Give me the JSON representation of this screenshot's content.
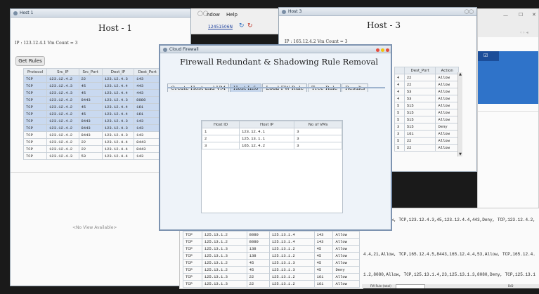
{
  "host1": {
    "title": "Host 1",
    "heading": "Host - 1",
    "ip_line": "IP : 123.12.4.1 Vm Count = 3",
    "get_rules": "Get Rules",
    "no_view": "<No View Available>",
    "columns": [
      "Protocol",
      "Src_IP",
      "Src_Port",
      "Dest_IP",
      "Dest_Port"
    ],
    "rows": [
      [
        "TCP",
        "123.12.4.2",
        "22",
        "123.12.4.3",
        "143"
      ],
      [
        "TCP",
        "123.12.4.3",
        "45",
        "123.12.4.4",
        "443"
      ],
      [
        "TCP",
        "123.12.4.3",
        "45",
        "123.12.4.4",
        "443"
      ],
      [
        "TCP",
        "123.12.4.2",
        "8443",
        "123.12.4.3",
        "8080"
      ],
      [
        "TCP",
        "123.12.4.2",
        "45",
        "123.12.4.4",
        "161"
      ],
      [
        "TCP",
        "123.12.4.2",
        "45",
        "123.12.4.4",
        "161"
      ],
      [
        "TCP",
        "123.12.4.2",
        "8443",
        "123.12.4.3",
        "143"
      ],
      [
        "TCP",
        "123.12.4.2",
        "8443",
        "123.12.4.3",
        "143"
      ],
      [
        "TCP",
        "123.12.4.2",
        "8443",
        "123.12.4.3",
        "143"
      ],
      [
        "TCP",
        "123.12.4.2",
        "22",
        "123.12.4.4",
        "8443"
      ],
      [
        "TCP",
        "123.12.4.2",
        "22",
        "123.12.4.4",
        "8443"
      ],
      [
        "TCP",
        "123.12.4.3",
        "53",
        "123.12.4.4",
        "143"
      ]
    ]
  },
  "menubar": {
    "window": "ndow",
    "help": "Help",
    "link": "12451506N"
  },
  "host3": {
    "title": "Host 3",
    "heading": "Host - 3",
    "ip_line": "IP : 165.12.4.2 Vm Count = 3",
    "columns": [
      "Dest_Port",
      "Action"
    ],
    "rows": [
      [
        "4",
        "22",
        "Allow"
      ],
      [
        "4",
        "22",
        "Allow"
      ],
      [
        "4",
        "53",
        "Allow"
      ],
      [
        "4",
        "53",
        "Allow"
      ],
      [
        "5",
        "515",
        "Allow"
      ],
      [
        "5",
        "515",
        "Allow"
      ],
      [
        "5",
        "515",
        "Allow"
      ],
      [
        "3",
        "515",
        "Deny"
      ],
      [
        "3",
        "161",
        "Allow"
      ],
      [
        "5",
        "22",
        "Allow"
      ],
      [
        "5",
        "22",
        "Allow"
      ]
    ]
  },
  "firewall": {
    "title": "Cloud Firewall",
    "heading": "Firewall Redundant & Shadowing Rule Removal",
    "tabs": [
      "Create Host and VM",
      "Host Info",
      "Load FW Rule",
      "Tree Rule",
      "Results"
    ],
    "active_tab": 1,
    "columns": [
      "Host ID",
      "Host IP",
      "No of VMs"
    ],
    "rows": [
      [
        "1",
        "123.12.4.1",
        "3"
      ],
      [
        "2",
        "125.13.1.1",
        "3"
      ],
      [
        "3",
        "165.12.4.2",
        "3"
      ]
    ]
  },
  "bottom_table": {
    "rows": [
      [
        "TCP",
        "125.13.1.2",
        "8080",
        "125.13.1.4",
        "143",
        "Allow"
      ],
      [
        "TCP",
        "125.13.1.2",
        "8080",
        "125.13.1.4",
        "143",
        "Allow"
      ],
      [
        "TCP",
        "125.13.1.3",
        "138",
        "125.13.1.2",
        "45",
        "Allow"
      ],
      [
        "TCP",
        "125.13.1.3",
        "138",
        "125.13.1.2",
        "45",
        "Allow"
      ],
      [
        "TCP",
        "125.13.1.2",
        "45",
        "125.13.1.3",
        "45",
        "Allow"
      ],
      [
        "TCP",
        "125.13.1.2",
        "45",
        "125.13.1.3",
        "45",
        "Deny"
      ],
      [
        "TCP",
        "125.13.1.3",
        "22",
        "125.13.1.2",
        "161",
        "Allow"
      ],
      [
        "TCP",
        "125.13.1.3",
        "22",
        "125.13.1.2",
        "161",
        "Allow"
      ]
    ]
  },
  "results": {
    "lines": [
      ".4,443,Allow, TCP,123.12.4.3,45,123.12.4.4,443,Deny, TCP,123.12.4.2,",
      "4.4,21,Allow, TCP,165.12.4.5,8443,165.12.4.4,53,Allow, TCP,165.12.4.",
      "1.2,8080,Allow, TCP,125.13.1.4,23,125.13.1.3,8080,Deny, TCP,125.13.1"
    ],
    "footer_left": "FW Rule (total)",
    "footer_right": "BrD"
  }
}
